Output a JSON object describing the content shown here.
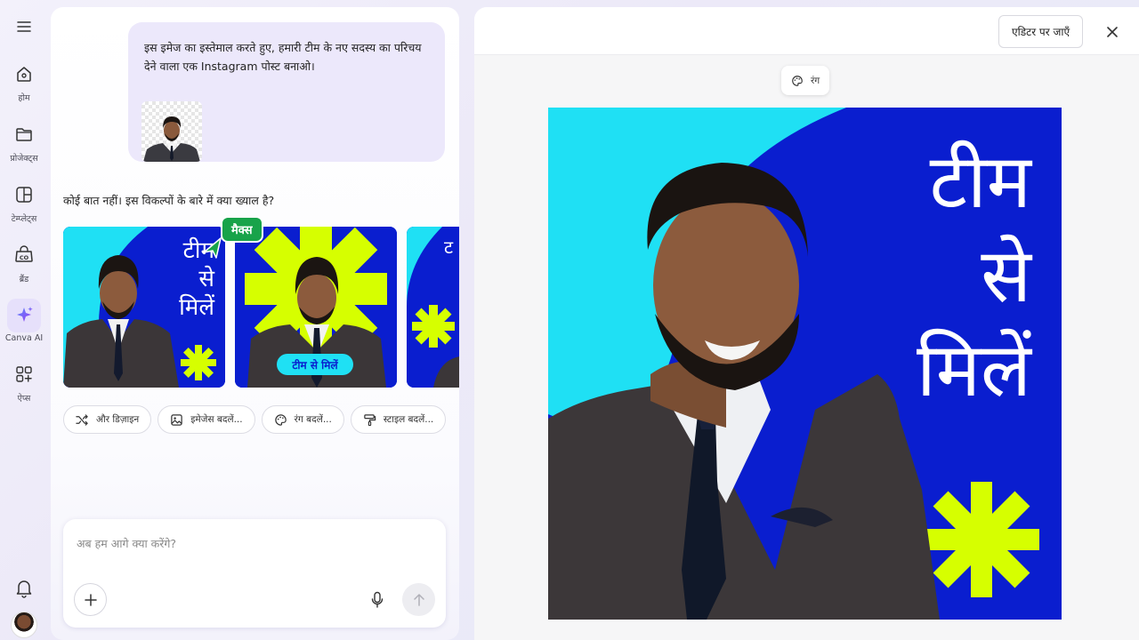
{
  "rail": {
    "items": [
      {
        "label": "होम",
        "icon": "home-icon"
      },
      {
        "label": "प्रोजेक्ट्स",
        "icon": "folder-icon"
      },
      {
        "label": "टेम्प्लेट्स",
        "icon": "template-icon"
      },
      {
        "label": "ब्रैंड",
        "icon": "brand-icon"
      },
      {
        "label": "Canva AI",
        "icon": "sparkle-icon"
      },
      {
        "label": "ऐप्स",
        "icon": "apps-icon"
      }
    ]
  },
  "chat": {
    "user_message": "इस इमेज का इस्तेमाल करते हुए, हमारी टीम के नए सदस्य का परिचय देने वाला एक Instagram पोस्ट बनाओ।",
    "reply": "कोई बात नहीं। इस विकल्पों के बारे में क्या ख्याल है?",
    "cursor_badge": "मैक्स",
    "option1_text": [
      "टीम",
      "से",
      "मिलें"
    ],
    "option2_badge": "टीम से मिलें",
    "option3_text": "ट",
    "chips": [
      "और डिज़ाइन",
      "इमेजेस बदलें...",
      "रंग बदलें...",
      "स्टाइल बदलें..."
    ],
    "composer_placeholder": "अब हम आगे क्या करेंगे?"
  },
  "preview": {
    "editor_button": "एडिटर पर जाएँ",
    "color_pill": "रंग",
    "title_lines": [
      "टीम",
      "से",
      "मिलें"
    ]
  },
  "colors": {
    "design_blue": "#0a1ecf",
    "cyan": "#1fe0f4",
    "lime": "#d6ff00",
    "badge_green": "#18a34a",
    "accent_purple": "#7c3aed"
  }
}
